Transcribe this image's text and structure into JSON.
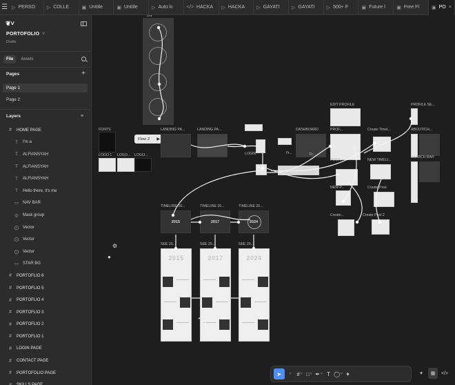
{
  "tabs": [
    {
      "icon": "play-icon",
      "label": "PERSO"
    },
    {
      "icon": "play-icon",
      "label": "COLLE"
    },
    {
      "icon": "file-icon",
      "label": "Untitle"
    },
    {
      "icon": "file-icon",
      "label": "Untitle"
    },
    {
      "icon": "play-icon",
      "label": "Auto lc"
    },
    {
      "icon": "code-icon",
      "label": "HACKA"
    },
    {
      "icon": "play-icon",
      "label": "HACKA"
    },
    {
      "icon": "play-icon",
      "label": "GAYATI"
    },
    {
      "icon": "play-icon",
      "label": "GAYATI"
    },
    {
      "icon": "play-icon",
      "label": "500+ F"
    },
    {
      "icon": "file-icon",
      "label": "Future l"
    },
    {
      "icon": "file-icon",
      "label": "Free Fl"
    },
    {
      "icon": "file-icon",
      "label": "PO"
    }
  ],
  "project": {
    "name": "PORTOFOLIO",
    "subtitle": "Drafts"
  },
  "panel_tabs": {
    "file": "File",
    "assets": "Assets"
  },
  "pages": {
    "title": "Pages",
    "items": [
      "Page 1",
      "Page 2"
    ],
    "active": "Page 1"
  },
  "layers": {
    "title": "Layers",
    "items": [
      {
        "label": "HOME PAGE",
        "icon": "frame",
        "level": "top"
      },
      {
        "label": "I'm a",
        "icon": "text",
        "level": "child"
      },
      {
        "label": "ALFIANSYAH",
        "icon": "text",
        "level": "child"
      },
      {
        "label": "ALFIANSYAH",
        "icon": "text",
        "level": "child"
      },
      {
        "label": "ALFIANSYAH",
        "icon": "text",
        "level": "child"
      },
      {
        "label": "Hello there, it's me",
        "icon": "text",
        "level": "child"
      },
      {
        "label": "NAV BAR",
        "icon": "rect",
        "level": "child"
      },
      {
        "label": "Mask group",
        "icon": "mask",
        "level": "child"
      },
      {
        "label": "Vector",
        "icon": "vector",
        "level": "child"
      },
      {
        "label": "Vector",
        "icon": "vector",
        "level": "child"
      },
      {
        "label": "Vector",
        "icon": "vector",
        "level": "child"
      },
      {
        "label": "STAR BG",
        "icon": "rect",
        "level": "child"
      },
      {
        "label": "PORTOFLIO 6",
        "icon": "frame",
        "level": "top"
      },
      {
        "label": "PORTOFLIO 5",
        "icon": "frame",
        "level": "top"
      },
      {
        "label": "PORTOFLIO 4",
        "icon": "frame",
        "level": "top"
      },
      {
        "label": "PORTOFLIO 3",
        "icon": "frame",
        "level": "top"
      },
      {
        "label": "PORTOFLIO 2",
        "icon": "frame",
        "level": "top"
      },
      {
        "label": "PORTOFLIO 1",
        "icon": "frame",
        "level": "top"
      },
      {
        "label": "LOGIN PAGE",
        "icon": "frame",
        "level": "top"
      },
      {
        "label": "CONTACT PAGE",
        "icon": "frame",
        "level": "top"
      },
      {
        "label": "PORTOFOLIO PAGE",
        "icon": "frame",
        "level": "top"
      },
      {
        "label": "SKILLS PAGE",
        "icon": "frame",
        "level": "top"
      }
    ]
  },
  "canvas": {
    "flow_button": "Flow 2",
    "labels": {
      "bg": "BG",
      "fonts": "FONTS",
      "landing1": "LANDING PA...",
      "landing2": "LANDING PA...",
      "logo1": "LOGO 1",
      "logo2": "LOGO...",
      "logo3": "LOGO...",
      "login": "LOGIN",
      "dashboard": "DASHBOARD",
      "edit_profile": "EDIT PROFILE",
      "profile": "PROF...",
      "create_timeline": "Create Timel...",
      "profile_se": "PROFILE SE...",
      "about": "ABOUT/CH...",
      "search_bar": "SEARCH BAR",
      "post": "POST...",
      "new_timeline": "NEW TIMELI...",
      "new_post": "NEW P...",
      "create_post": "Create Post",
      "create": "Create...",
      "create_post2": "Create Post 2",
      "fr1": "Fr...",
      "fr2": "Fr...",
      "tl1": "TIMELINE 20...",
      "tl2": "TIMELINE 20...",
      "tl3": "TIMELINE 20...",
      "see1": "SEE 20...",
      "see2": "SEE 20...",
      "see3": "SEE 20...",
      "tl_year1": "2015",
      "tl_year2": "2017",
      "tl_year3": "2024",
      "card_year1": "2015",
      "card_year2": "2017",
      "card_year3": "2024"
    }
  },
  "toolbar": {
    "tools": [
      "move-tool",
      "frame-tool",
      "shape-tool",
      "pen-tool",
      "text-tool",
      "comment-tool",
      "actions-tool"
    ],
    "active": "move-tool"
  },
  "colors": {
    "accent": "#4f8ff7",
    "canvas": "#1e1e1e",
    "panel": "#2c2c2c"
  }
}
